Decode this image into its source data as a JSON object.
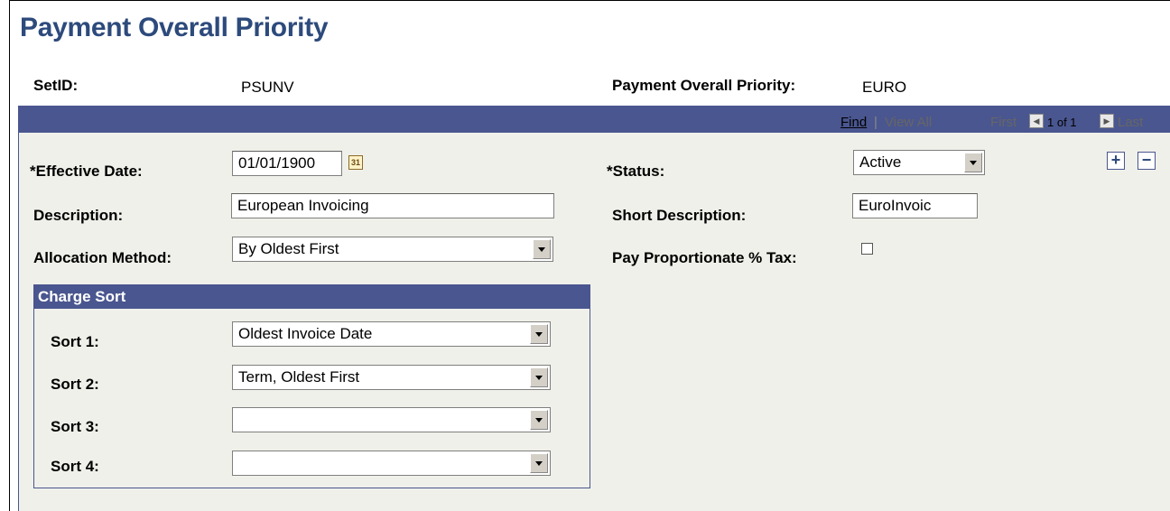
{
  "page_title": "Payment Overall Priority",
  "header": {
    "setid_label": "SetID:",
    "setid_value": "PSUNV",
    "priority_label": "Payment Overall Priority:",
    "priority_value": "EURO"
  },
  "nav": {
    "find": "Find",
    "sep1": "|",
    "view_all": "View All",
    "first": "First",
    "page_of": "1 of 1",
    "last": "Last"
  },
  "form": {
    "effective_date_label": "*Effective Date:",
    "effective_date_value": "01/01/1900",
    "calendar_glyph": "31",
    "status_label": "*Status:",
    "status_value": "Active",
    "description_label": "Description:",
    "description_value": "European Invoicing",
    "short_description_label": "Short Description:",
    "short_description_value": "EuroInvoic",
    "allocation_label": "Allocation Method:",
    "allocation_value": "By Oldest First",
    "pay_tax_label": "Pay Proportionate % Tax:",
    "add_row": "+",
    "delete_row": "−"
  },
  "charge_sort": {
    "title": "Charge Sort",
    "sorts": [
      {
        "label": "Sort 1:",
        "value": "Oldest Invoice Date"
      },
      {
        "label": "Sort 2:",
        "value": "Term, Oldest First"
      },
      {
        "label": "Sort 3:",
        "value": ""
      },
      {
        "label": "Sort 4:",
        "value": ""
      }
    ]
  },
  "colors": {
    "title_blue": "#2d4a7c",
    "header_bar": "#4a568f",
    "panel_bg": "#f0f0ea"
  }
}
